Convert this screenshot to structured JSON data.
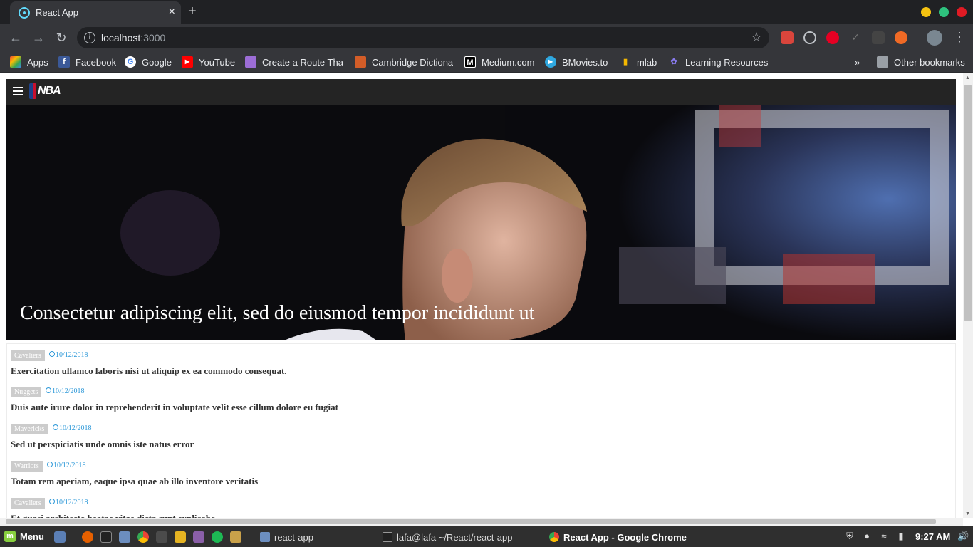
{
  "browser": {
    "tab_title": "React App",
    "new_tab_symbol": "+",
    "close_symbol": "×",
    "url_host": "localhost",
    "url_port": ":3000",
    "menu_symbol": "⋮"
  },
  "bookmarks": {
    "items": [
      {
        "label": "Apps",
        "icon": "apps-grid-icon",
        "color": "#e8453c"
      },
      {
        "label": "Facebook",
        "icon": "facebook-icon",
        "color": "#3b5998"
      },
      {
        "label": "Google",
        "icon": "google-icon",
        "color": "#ffffff"
      },
      {
        "label": "YouTube",
        "icon": "youtube-icon",
        "color": "#ff0000"
      },
      {
        "label": "Create a Route That",
        "icon": "cloud-icon",
        "color": "#9c6dd6"
      },
      {
        "label": "Cambridge Dictiona",
        "icon": "cambridge-shield-icon",
        "color": "#d35d28"
      },
      {
        "label": "Medium.com",
        "icon": "medium-icon",
        "color": "#000000"
      },
      {
        "label": "BMovies.to",
        "icon": "play-icon",
        "color": "#2fa8e0"
      },
      {
        "label": "mlab",
        "icon": "mlab-icon",
        "color": "#f5b800"
      },
      {
        "label": "Learning Resources",
        "icon": "learning-icon",
        "color": "#6a5acd"
      }
    ],
    "overflow": "»",
    "other": "Other bookmarks"
  },
  "app": {
    "hero_title": "Consectetur adipiscing elit, sed do eiusmod tempor incididunt ut",
    "news": [
      {
        "team": "Cavaliers",
        "date": "10/12/2018",
        "title": "Exercitation ullamco laboris nisi ut aliquip ex ea commodo consequat."
      },
      {
        "team": "Nuggets",
        "date": "10/12/2018",
        "title": "Duis aute irure dolor in reprehenderit in voluptate velit esse cillum dolore eu fugiat"
      },
      {
        "team": "Mavericks",
        "date": "10/12/2018",
        "title": "Sed ut perspiciatis unde omnis iste natus error"
      },
      {
        "team": "Warriors",
        "date": "10/12/2018",
        "title": "Totam rem aperiam, eaque ipsa quae ab illo inventore veritatis"
      },
      {
        "team": "Cavaliers",
        "date": "10/12/2018",
        "title": "Et quasi architecto beatae vitae dicta sunt explicabo"
      }
    ]
  },
  "taskbar": {
    "menu_label": "Menu",
    "tasks": [
      {
        "label": "react-app"
      },
      {
        "label": "lafa@lafa ~/React/react-app"
      },
      {
        "label": "React App - Google Chrome"
      }
    ],
    "clock": "9:27 AM"
  },
  "colors": {
    "chrome_dark": "#202124",
    "toolbar": "#35363a",
    "nba_header": "#242424",
    "date_blue": "#2c98d8",
    "team_badge": "#cccccc"
  }
}
